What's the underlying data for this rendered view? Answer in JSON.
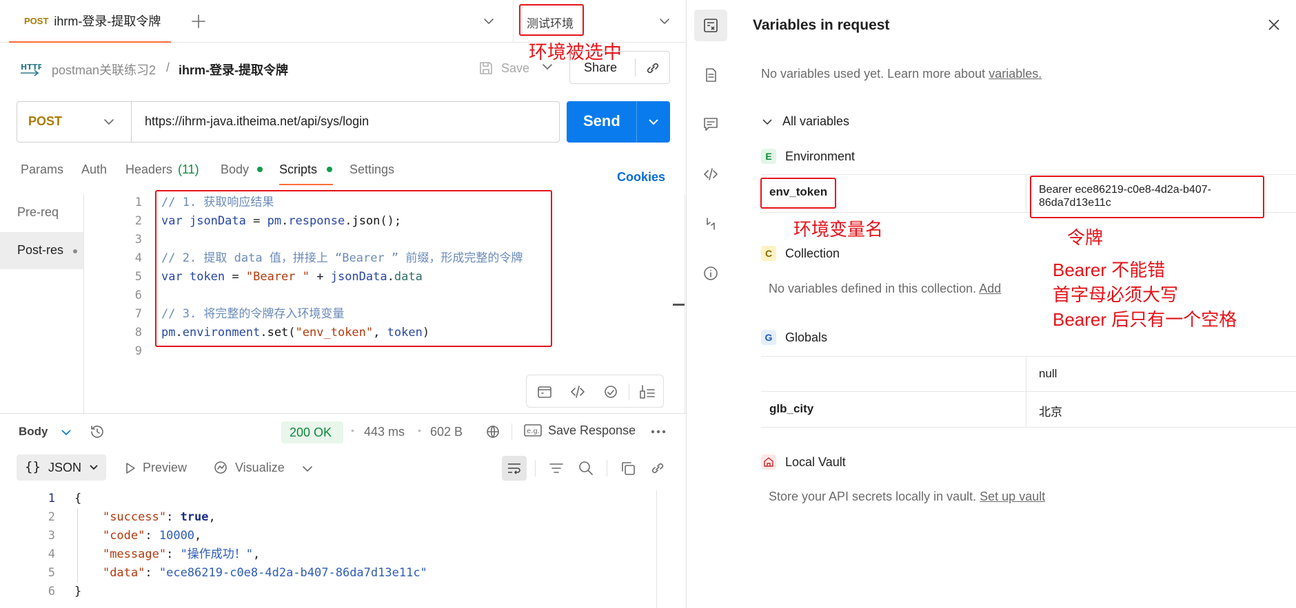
{
  "tab": {
    "method": "POST",
    "title": "ihrm-登录-提取令牌"
  },
  "environment": {
    "name": "测试环境"
  },
  "annotations": {
    "env_selected": "环境被选中",
    "env_var_name": "环境变量名",
    "token_label": "令牌",
    "notes": [
      "Bearer 不能错",
      "首字母必须大写",
      "Bearer 后只有一个空格"
    ]
  },
  "breadcrumb": {
    "collection": "postman关联练习2",
    "separator": "/",
    "request": "ihrm-登录-提取令牌",
    "protocol_badge": "HTTP"
  },
  "toolbar": {
    "save": "Save",
    "share": "Share"
  },
  "request": {
    "method": "POST",
    "url": "https://ihrm-java.itheima.net/api/sys/login",
    "send": "Send"
  },
  "request_tabs": {
    "params": "Params",
    "auth": "Auth",
    "headers": "Headers",
    "headers_count": "(11)",
    "body": "Body",
    "scripts": "Scripts",
    "settings": "Settings",
    "cookies": "Cookies"
  },
  "script_tabs": {
    "pre": "Pre-req",
    "post": "Post-res"
  },
  "script_lines": [
    "// 1. 获取响应结果",
    "var jsonData = pm.response.json();",
    "",
    "// 2. 提取 data 值，拼接上 “Bearer ” 前缀，形成完整的令牌",
    "var token = \"Bearer \" + jsonData.data",
    "",
    "// 3. 将完整的令牌存入环境变量",
    "pm.environment.set(\"env_token\", token)",
    ""
  ],
  "response": {
    "body_label": "Body",
    "status": "200 OK",
    "time": "443 ms",
    "size": "602 B",
    "save_response": "Save Response",
    "format": "JSON",
    "preview": "Preview",
    "visualize": "Visualize",
    "lines": [
      "{",
      "    \"success\": true,",
      "    \"code\": 10000,",
      "    \"message\": \"操作成功！\",",
      "    \"data\": \"ece86219-c0e8-4d2a-b407-86da7d13e11c\"",
      "}"
    ]
  },
  "variables_panel": {
    "title": "Variables in request",
    "intro": "No variables used yet. Learn more about",
    "intro_link": "variables.",
    "all_variables": "All variables",
    "environment": {
      "badge": "E",
      "label": "Environment",
      "key": "env_token",
      "value_line1": "Bearer ece86219-c0e8-4d2a-b407-",
      "value_line2": "86da7d13e11c"
    },
    "collection": {
      "badge": "C",
      "label": "Collection",
      "empty": "No variables defined in this collection.",
      "add": "Add"
    },
    "globals": {
      "badge": "G",
      "label": "Globals",
      "rows": [
        {
          "key": "",
          "value": "null"
        },
        {
          "key": "glb_city",
          "value": "北京"
        }
      ]
    },
    "vault": {
      "label": "Local Vault",
      "text": "Store your API secrets locally in vault.",
      "link": "Set up vault"
    }
  },
  "colors": {
    "accent": "#ff6c37",
    "send": "#097bed",
    "annotation": "#e6131a",
    "status_ok": "#0f8a3b"
  }
}
